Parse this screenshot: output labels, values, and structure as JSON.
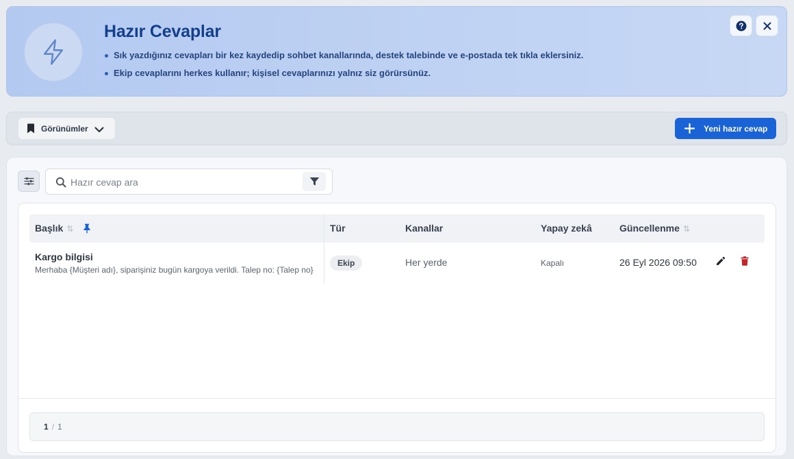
{
  "banner": {
    "title": "Hazır Cevaplar",
    "bullets": [
      "Sık yazdığınız cevapları bir kez kaydedip sohbet kanallarında, destek talebinde ve e-postada tek tıkla eklersiniz.",
      "Ekip cevaplarını herkes kullanır; kişisel cevaplarınızı yalnız siz görürsünüz."
    ],
    "badge_icon": "lightning-icon",
    "help_icon": "question-circle-icon",
    "close_icon": "close-icon"
  },
  "toolbar": {
    "views_label": "Görünümler",
    "views_icon": "bookmark-icon",
    "new_label": "Yeni hazır cevap",
    "new_icon": "plus-icon"
  },
  "search": {
    "placeholder": "Hazır cevap ara",
    "value": ""
  },
  "table": {
    "columns": {
      "title": "Başlık",
      "type": "Tür",
      "channels": "Kanallar",
      "ai": "Yapay zekâ",
      "updated": "Güncellenme"
    },
    "sort_glyph": "⇅",
    "rows": [
      {
        "title": "Kargo bilgisi",
        "body": "Merhaba {Müşteri adı}, siparişiniz bugün kargoya verildi. Talep no: {Talep no}",
        "type": "Ekip",
        "channels": "Her yerde",
        "ai": "Kapalı",
        "updated": "26 Eyl 2026 09:50"
      }
    ]
  },
  "pagination": {
    "current": "1",
    "separator": "/",
    "total": "1"
  },
  "colors": {
    "brand_blue": "#1a63d6",
    "title_blue": "#143f8a",
    "delete_red": "#c0262d",
    "banner_bg": "#b8cdf1"
  }
}
